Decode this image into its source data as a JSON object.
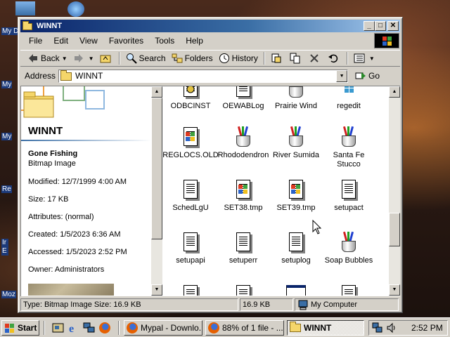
{
  "desktop": {
    "icons": [
      {
        "label": "My D"
      },
      {
        "label": "My"
      },
      {
        "label": "My"
      },
      {
        "label": "Re"
      },
      {
        "label": "Ir E"
      },
      {
        "label": "Moz"
      }
    ]
  },
  "window": {
    "title": "WINNT",
    "controls": {
      "minimize": "_",
      "maximize": "□",
      "close": "✕"
    }
  },
  "menubar": {
    "items": [
      "File",
      "Edit",
      "View",
      "Favorites",
      "Tools",
      "Help"
    ]
  },
  "toolbar": {
    "back": "Back",
    "search": "Search",
    "folders": "Folders",
    "history": "History"
  },
  "addressbar": {
    "label": "Address",
    "value": "WINNT",
    "go": "Go"
  },
  "details_pane": {
    "folder_title": "WINNT",
    "file_name": "Gone Fishing",
    "file_type": "Bitmap Image",
    "modified": "Modified: 12/7/1999 4:00 AM",
    "size": "Size: 17 KB",
    "attributes": "Attributes: (normal)",
    "created": "Created: 1/5/2023 6:36 AM",
    "accessed": "Accessed: 1/5/2023 2:52 PM",
    "owner": "Owner: Administrators"
  },
  "files": [
    {
      "name": "ODBCINST",
      "icon": "gear-document-icon"
    },
    {
      "name": "OEWABLog",
      "icon": "document-icon"
    },
    {
      "name": "Prairie Wind",
      "icon": "paint-icon"
    },
    {
      "name": "regedit",
      "icon": "registry-icon"
    },
    {
      "name": "REGLOCS.OLD",
      "icon": "windows-document-icon"
    },
    {
      "name": "Rhododendron",
      "icon": "paint-icon"
    },
    {
      "name": "River Sumida",
      "icon": "paint-icon"
    },
    {
      "name": "Santa Fe Stucco",
      "icon": "paint-icon"
    },
    {
      "name": "SchedLgU",
      "icon": "text-document-icon"
    },
    {
      "name": "SET38.tmp",
      "icon": "windows-document-icon"
    },
    {
      "name": "SET39.tmp",
      "icon": "windows-document-icon"
    },
    {
      "name": "setupact",
      "icon": "text-document-icon"
    },
    {
      "name": "setupapi",
      "icon": "text-document-icon"
    },
    {
      "name": "setuperr",
      "icon": "text-document-icon"
    },
    {
      "name": "setuplog",
      "icon": "text-document-icon"
    },
    {
      "name": "Soap Bubbles",
      "icon": "paint-icon"
    }
  ],
  "statusbar": {
    "description": "Type: Bitmap Image Size: 16.9 KB",
    "size": "16.9 KB",
    "zone": "My Computer"
  },
  "taskbar": {
    "start": "Start",
    "tasks": [
      "Mypal - Downlo...",
      "88% of 1 file - ...",
      "WINNT"
    ],
    "clock": "2:52 PM"
  },
  "colors": {
    "titlebar_start": "#0a246a",
    "titlebar_end": "#a6caf0",
    "chrome": "#d4d0c8"
  }
}
